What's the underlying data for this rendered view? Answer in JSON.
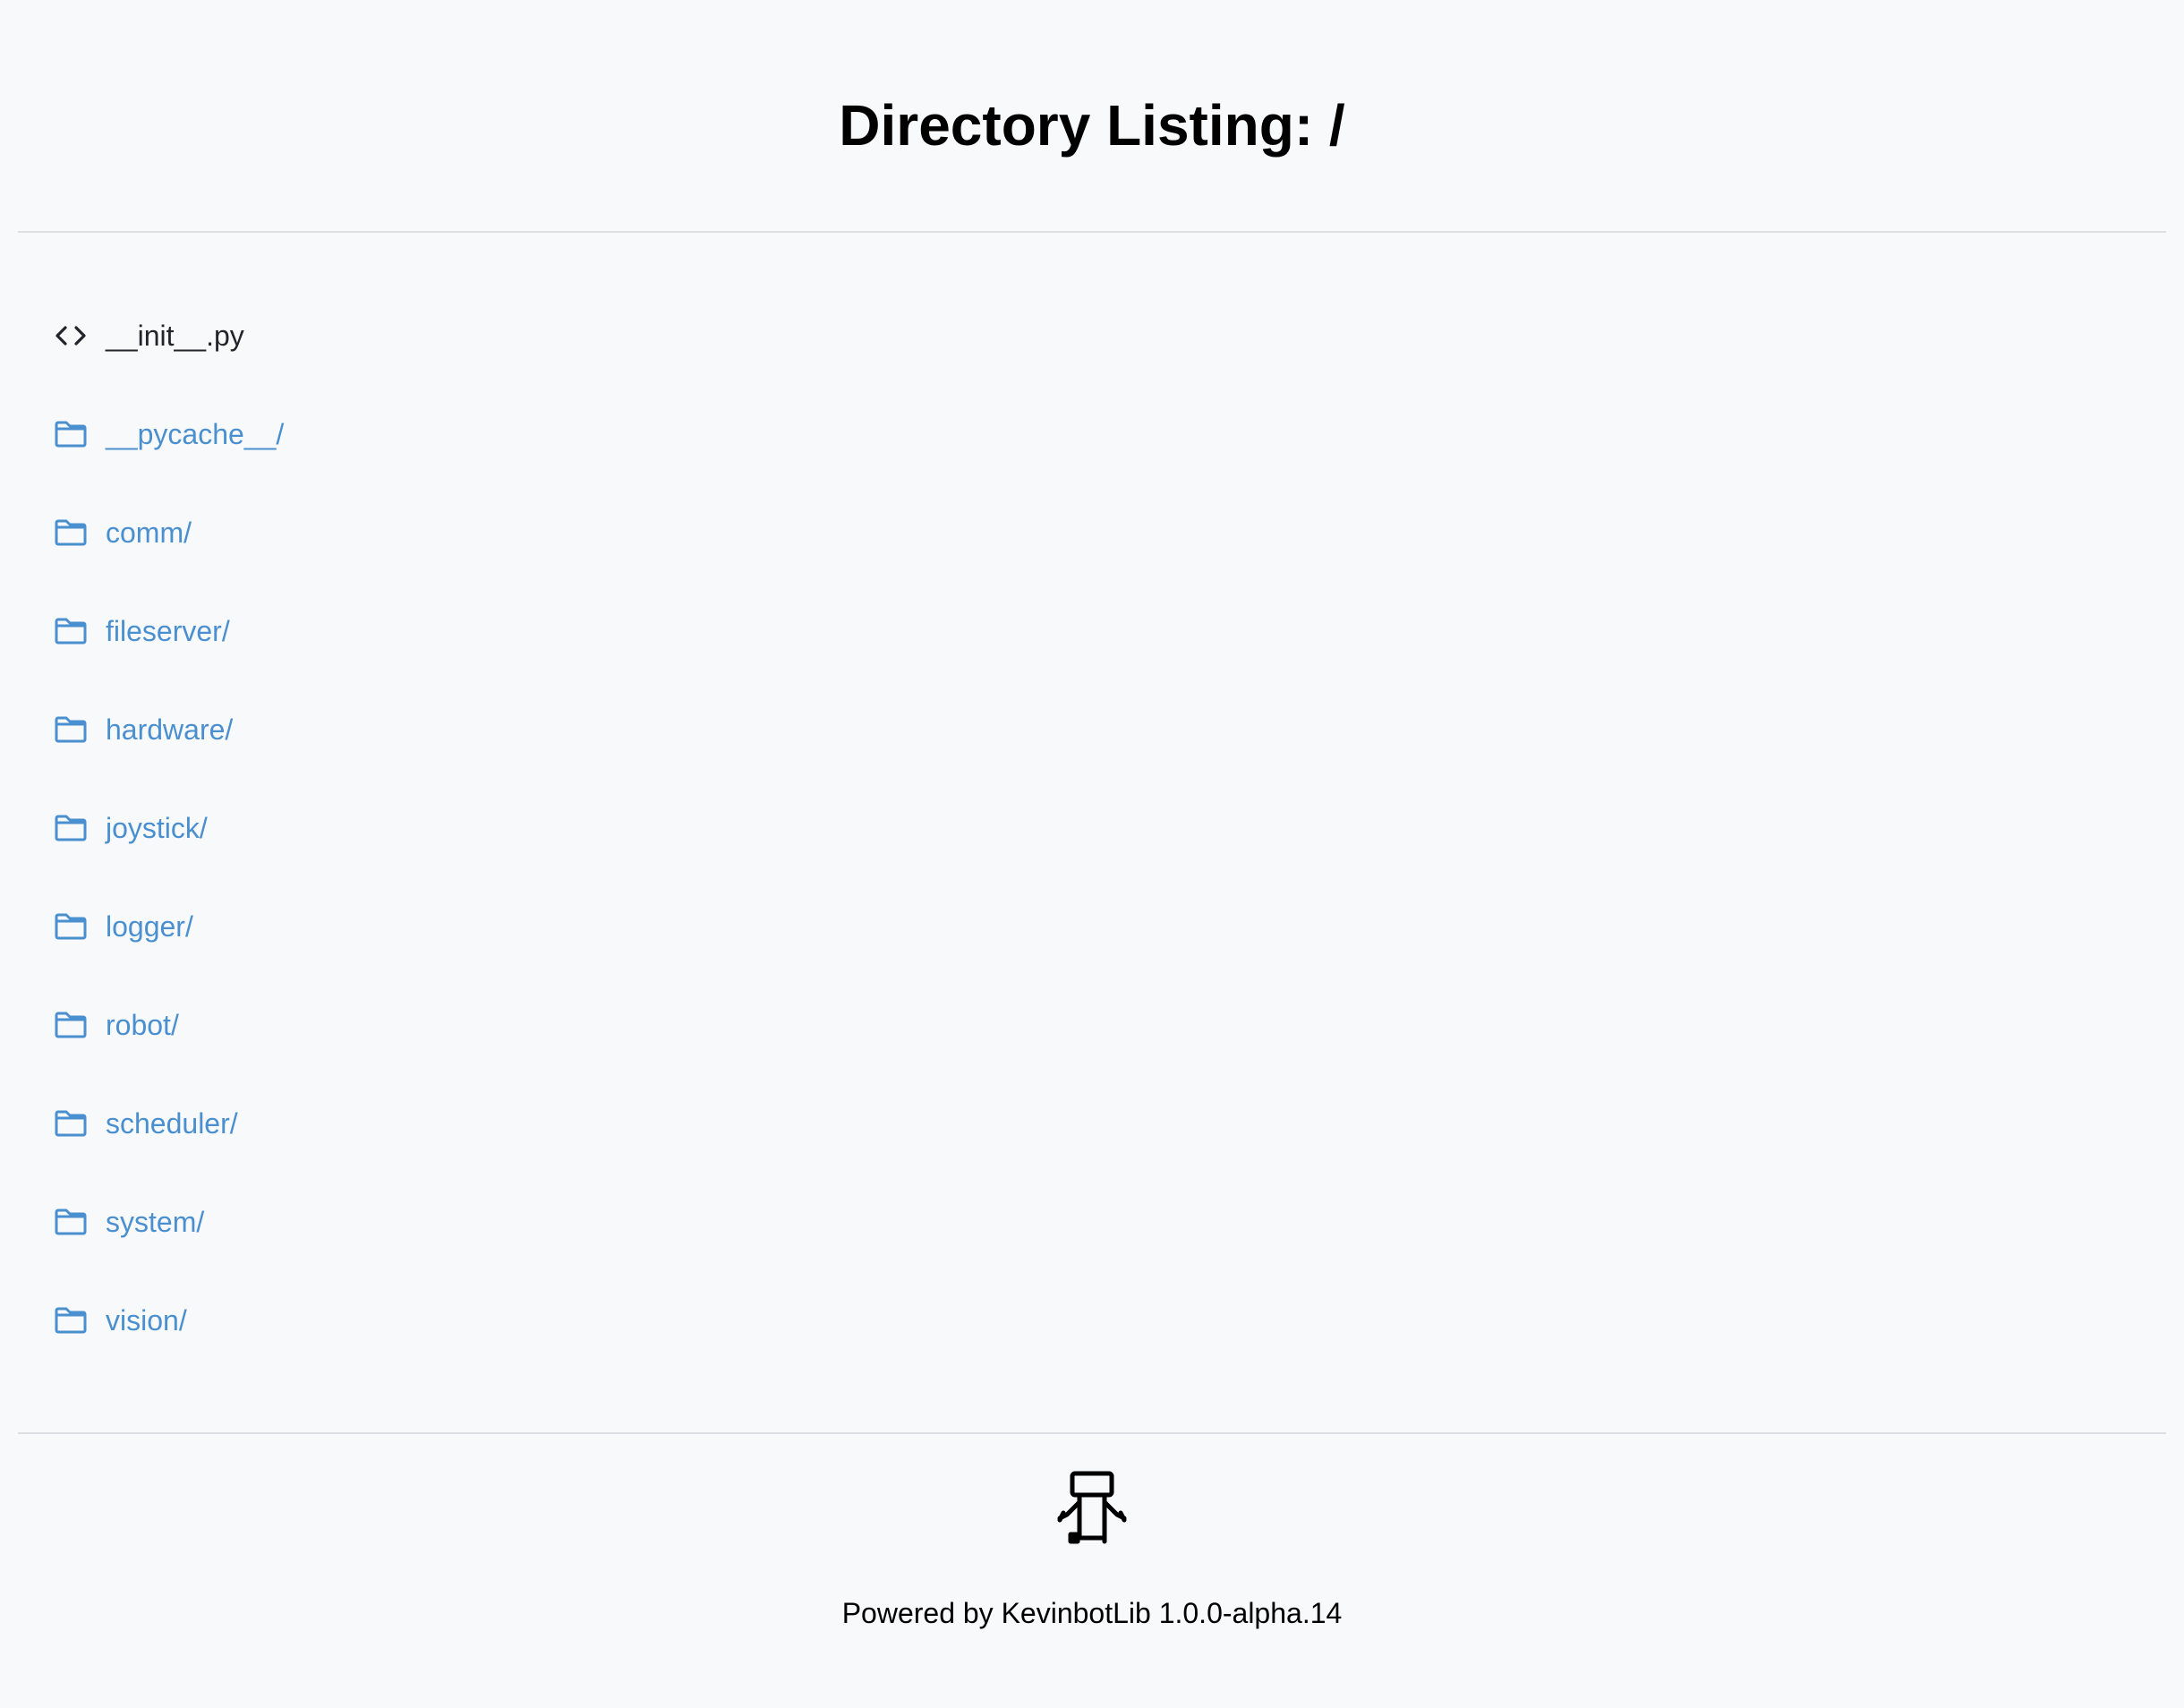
{
  "header": {
    "title": "Directory Listing: /"
  },
  "entries": [
    {
      "name": "__init__.py",
      "kind": "file",
      "icon": "code-icon"
    },
    {
      "name": "__pycache__/",
      "kind": "dir",
      "icon": "folder-icon"
    },
    {
      "name": "comm/",
      "kind": "dir",
      "icon": "folder-icon"
    },
    {
      "name": "fileserver/",
      "kind": "dir",
      "icon": "folder-icon"
    },
    {
      "name": "hardware/",
      "kind": "dir",
      "icon": "folder-icon"
    },
    {
      "name": "joystick/",
      "kind": "dir",
      "icon": "folder-icon"
    },
    {
      "name": "logger/",
      "kind": "dir",
      "icon": "folder-icon"
    },
    {
      "name": "robot/",
      "kind": "dir",
      "icon": "folder-icon"
    },
    {
      "name": "scheduler/",
      "kind": "dir",
      "icon": "folder-icon"
    },
    {
      "name": "system/",
      "kind": "dir",
      "icon": "folder-icon"
    },
    {
      "name": "vision/",
      "kind": "dir",
      "icon": "folder-icon"
    }
  ],
  "footer": {
    "logo_icon": "robot-logo-icon",
    "text": "Powered by KevinbotLib 1.0.0-alpha.14"
  },
  "colors": {
    "background": "#f8f9fa",
    "link": "#4a8fd0",
    "text": "#212529",
    "divider": "#dcdfe3"
  }
}
